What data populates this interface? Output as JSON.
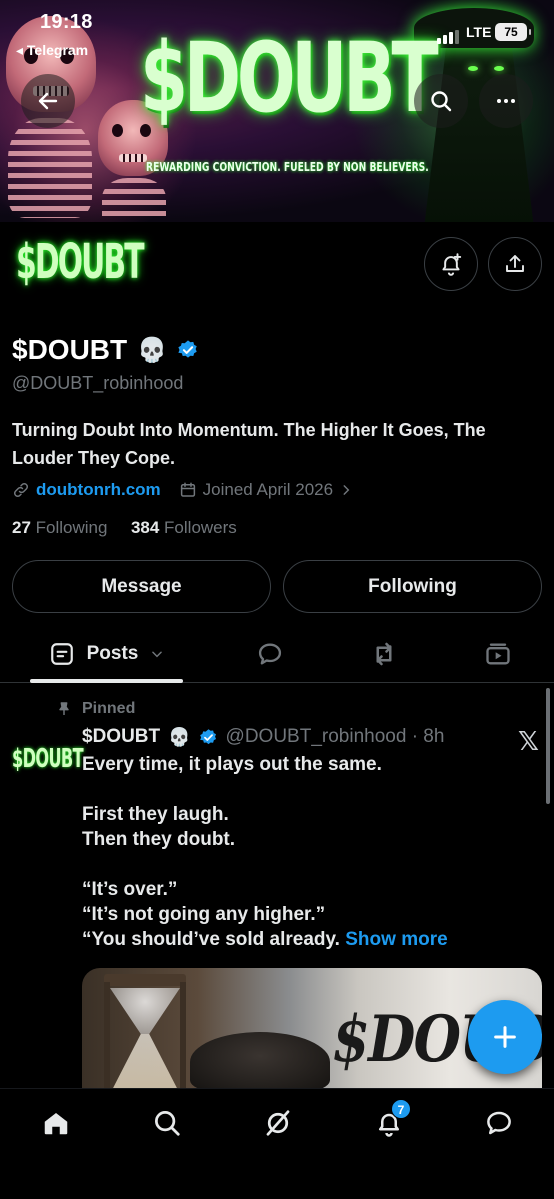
{
  "status_bar": {
    "time": "19:18",
    "back_app": "◂ Telegram",
    "network": "LTE",
    "battery": "75"
  },
  "banner": {
    "title": "$DOUBT",
    "subtitle": "REWARDING CONVICTION. FUELED BY NON BELIEVERS."
  },
  "profile": {
    "avatar_text": "$DOUBT",
    "display_name": "$DOUBT",
    "name_emoji": "💀",
    "handle": "@DOUBT_robinhood",
    "bio": "Turning Doubt Into Momentum. The Higher It Goes, The Louder They Cope.",
    "website": "doubtonrh.com",
    "joined": "Joined April 2026",
    "following_count": "27",
    "following_label": "Following",
    "followers_count": "384",
    "followers_label": "Followers"
  },
  "actions": {
    "message_label": "Message",
    "following_label": "Following"
  },
  "tabs": {
    "posts_label": "Posts"
  },
  "pinned_post": {
    "pinned_label": "Pinned",
    "avatar_text": "$DOUBT",
    "author": "$DOUBT",
    "author_emoji": "💀",
    "handle_time": "@DOUBT_robinhood · 8h",
    "lines": [
      "Every time, it plays out the same.",
      "",
      "First they laugh.",
      "Then they doubt.",
      "",
      "“It’s over.”",
      "“It’s not going any higher.”",
      "“You should’ve sold already."
    ],
    "show_more": "Show more",
    "image_text": "$DOUBT"
  },
  "bottom_nav": {
    "notifications_badge": "7"
  },
  "colors": {
    "accent": "#1d9bf0",
    "background": "#000000",
    "text_primary": "#e7e9ea",
    "text_secondary": "#71767b",
    "neon_green": "#46ff3e"
  }
}
